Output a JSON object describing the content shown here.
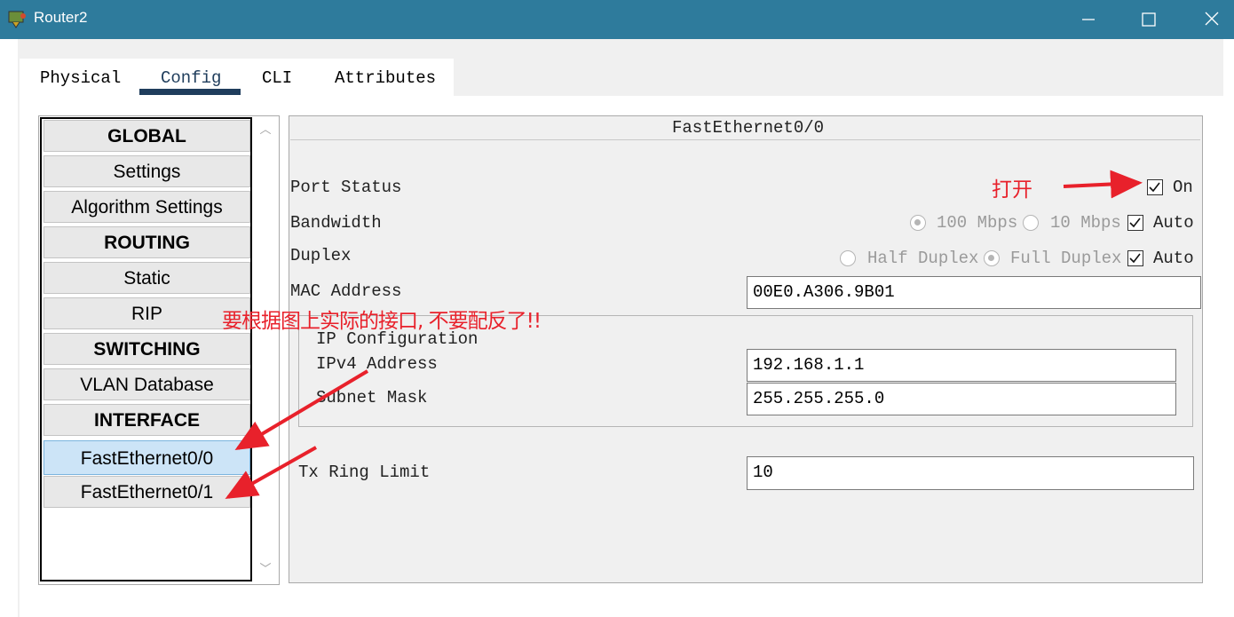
{
  "window": {
    "title": "Router2"
  },
  "tabs": [
    "Physical",
    "Config",
    "CLI",
    "Attributes"
  ],
  "sidebar": {
    "items": [
      {
        "label": "GLOBAL",
        "header": true
      },
      {
        "label": "Settings"
      },
      {
        "label": "Algorithm Settings"
      },
      {
        "label": "ROUTING",
        "header": true
      },
      {
        "label": "Static"
      },
      {
        "label": "RIP"
      },
      {
        "label": "SWITCHING",
        "header": true
      },
      {
        "label": "VLAN Database"
      },
      {
        "label": "INTERFACE",
        "header": true
      },
      {
        "label": "FastEthernet0/0",
        "selected": true
      },
      {
        "label": "FastEthernet0/1"
      }
    ]
  },
  "main": {
    "title": "FastEthernet0/0",
    "port_status_label": "Port Status",
    "port_status_on_label": "On",
    "port_status_on": true,
    "bandwidth_label": "Bandwidth",
    "bw_100": "100 Mbps",
    "bw_10": "10 Mbps",
    "bw_auto": "Auto",
    "duplex_label": "Duplex",
    "half_duplex": "Half Duplex",
    "full_duplex": "Full Duplex",
    "duplex_auto": "Auto",
    "mac_label": "MAC Address",
    "mac_value": "00E0.A306.9B01",
    "ip_config_label": "IP Configuration",
    "ipv4_label": "IPv4 Address",
    "ipv4_value": "192.168.1.1",
    "subnet_label": "Subnet Mask",
    "subnet_value": "255.255.255.0",
    "tx_ring_label": "Tx Ring Limit",
    "tx_ring_value": "10"
  },
  "annotations": {
    "open": "打开",
    "warning": "要根据图上实际的接口, 不要配反了!!"
  },
  "colors": {
    "titlebar": "#2e7b9c",
    "annotation": "#e8212b",
    "selected": "#cce4f7"
  }
}
